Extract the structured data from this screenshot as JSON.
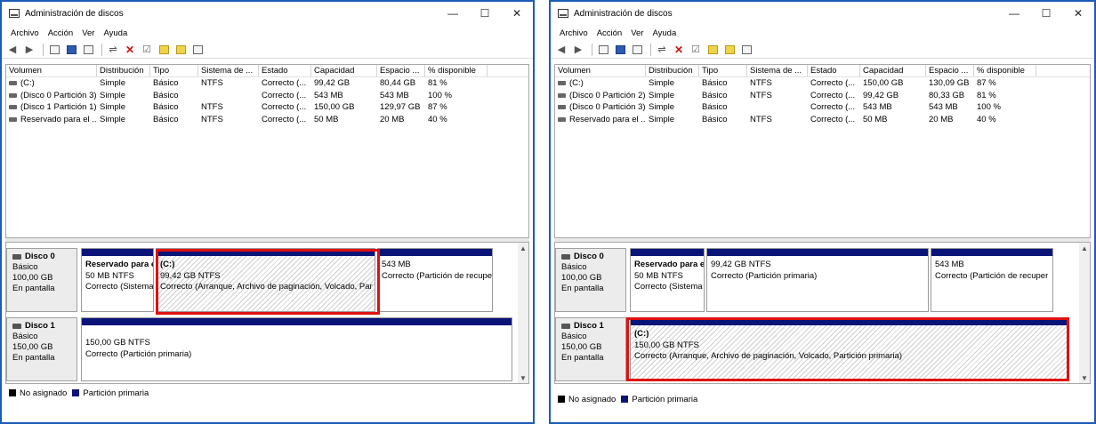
{
  "colors": {
    "title_border": "#1b5cb8",
    "primary_partition": "#0a1478",
    "unallocated": "#000000",
    "highlight": "#e01010"
  },
  "windows": [
    {
      "title": "Administración de discos",
      "menu": [
        "Archivo",
        "Acción",
        "Ver",
        "Ayuda"
      ],
      "columns": [
        "Volumen",
        "Distribución",
        "Tipo",
        "Sistema de ...",
        "Estado",
        "Capacidad",
        "Espacio ...",
        "% disponible"
      ],
      "volumes": [
        {
          "name": "(C:)",
          "layout": "Simple",
          "type": "Básico",
          "fs": "NTFS",
          "status": "Correcto (...",
          "capacity": "99,42 GB",
          "free": "80,44 GB",
          "pct": "81 %"
        },
        {
          "name": "(Disco 0 Partición 3)",
          "layout": "Simple",
          "type": "Básico",
          "fs": "",
          "status": "Correcto (...",
          "capacity": "543 MB",
          "free": "543 MB",
          "pct": "100 %"
        },
        {
          "name": "(Disco 1 Partición 1)",
          "layout": "Simple",
          "type": "Básico",
          "fs": "NTFS",
          "status": "Correcto (...",
          "capacity": "150,00 GB",
          "free": "129,97 GB",
          "pct": "87 %"
        },
        {
          "name": "Reservado para el ...",
          "layout": "Simple",
          "type": "Básico",
          "fs": "NTFS",
          "status": "Correcto (...",
          "capacity": "50 MB",
          "free": "20 MB",
          "pct": "40 %"
        }
      ],
      "disks": [
        {
          "name": "Disco 0",
          "kind": "Básico",
          "size": "100,00 GB",
          "state": "En pantalla",
          "partitions": [
            {
              "name": "Reservado para el",
              "size": "50 MB NTFS",
              "status": "Correcto (Sistema",
              "hatch": false
            },
            {
              "name": "(C:)",
              "size": "99,42 GB NTFS",
              "status": "Correcto (Arranque, Archivo de paginación, Volcado, Par",
              "hatch": true
            },
            {
              "name": "",
              "size": "543 MB",
              "status": "Correcto (Partición de recuper",
              "hatch": false
            }
          ]
        },
        {
          "name": "Disco 1",
          "kind": "Básico",
          "size": "150,00 GB",
          "state": "En pantalla",
          "partitions": [
            {
              "name": "",
              "size": "150,00 GB NTFS",
              "status": "Correcto (Partición primaria)",
              "hatch": false
            }
          ]
        }
      ],
      "legend": {
        "unallocated": "No asignado",
        "primary": "Partición primaria"
      }
    },
    {
      "title": "Administración de discos",
      "menu": [
        "Archivo",
        "Acción",
        "Ver",
        "Ayuda"
      ],
      "columns": [
        "Volumen",
        "Distribución",
        "Tipo",
        "Sistema de ...",
        "Estado",
        "Capacidad",
        "Espacio ...",
        "% disponible"
      ],
      "volumes": [
        {
          "name": "(C:)",
          "layout": "Simple",
          "type": "Básico",
          "fs": "NTFS",
          "status": "Correcto (...",
          "capacity": "150,00 GB",
          "free": "130,09 GB",
          "pct": "87 %"
        },
        {
          "name": "(Disco 0 Partición 2)",
          "layout": "Simple",
          "type": "Básico",
          "fs": "NTFS",
          "status": "Correcto (...",
          "capacity": "99,42 GB",
          "free": "80,33 GB",
          "pct": "81 %"
        },
        {
          "name": "(Disco 0 Partición 3)",
          "layout": "Simple",
          "type": "Básico",
          "fs": "",
          "status": "Correcto (...",
          "capacity": "543 MB",
          "free": "543 MB",
          "pct": "100 %"
        },
        {
          "name": "Reservado para el ...",
          "layout": "Simple",
          "type": "Básico",
          "fs": "NTFS",
          "status": "Correcto (...",
          "capacity": "50 MB",
          "free": "20 MB",
          "pct": "40 %"
        }
      ],
      "disks": [
        {
          "name": "Disco 0",
          "kind": "Básico",
          "size": "100,00 GB",
          "state": "En pantalla",
          "partitions": [
            {
              "name": "Reservado para el",
              "size": "50 MB NTFS",
              "status": "Correcto (Sistema",
              "hatch": false
            },
            {
              "name": "",
              "size": "99,42 GB NTFS",
              "status": "Correcto (Partición primaria)",
              "hatch": false
            },
            {
              "name": "",
              "size": "543 MB",
              "status": "Correcto (Partición de recuper",
              "hatch": false
            }
          ]
        },
        {
          "name": "Disco 1",
          "kind": "Básico",
          "size": "150,00 GB",
          "state": "En pantalla",
          "partitions": [
            {
              "name": "(C:)",
              "size": "150,00 GB NTFS",
              "status": "Correcto (Arranque, Archivo de paginación, Volcado, Partición primaria)",
              "hatch": true
            }
          ]
        }
      ],
      "legend": {
        "unallocated": "No asignado",
        "primary": "Partición primaria"
      }
    }
  ]
}
